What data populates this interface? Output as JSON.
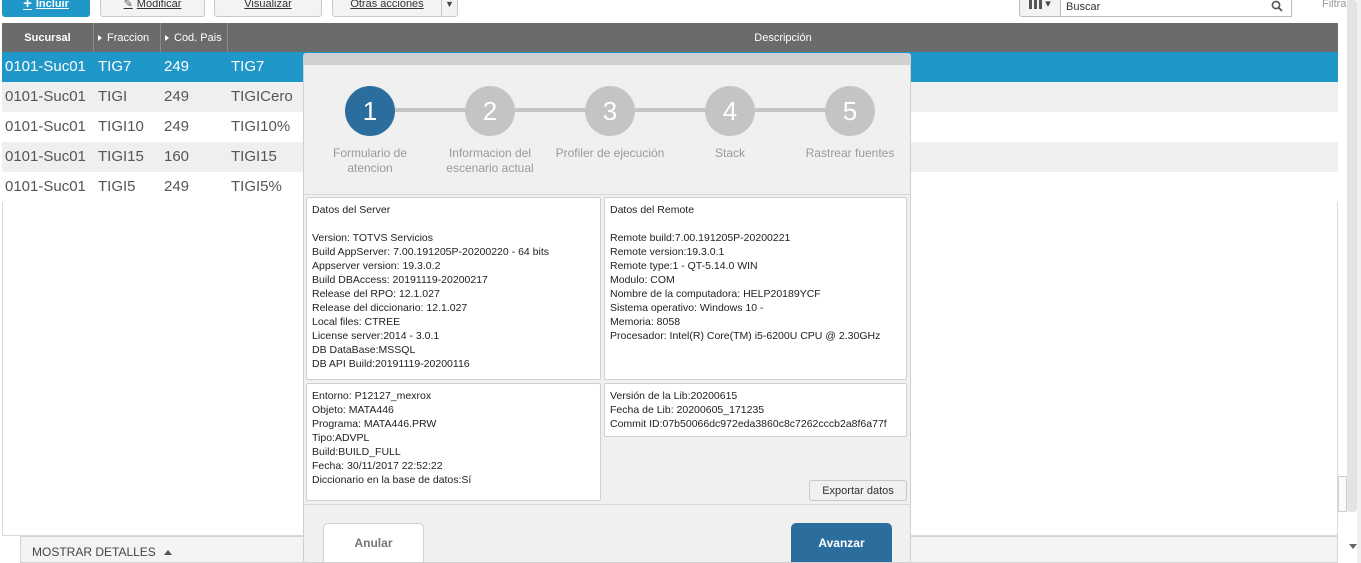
{
  "toolbar": {
    "include_label": "Incluir",
    "modify_label": "Modificar",
    "view_label": "Visualizar",
    "other_actions_label": "Otras acciones",
    "search_placeholder": "Buscar",
    "filter_label": "Filtrar"
  },
  "grid": {
    "columns": [
      "Sucursal",
      "Fraccion",
      "Cod. Pais",
      "Descripción"
    ],
    "rows": [
      {
        "sucursal": "0101-Suc01",
        "fraccion": "TIG7",
        "cod_pais": "249",
        "descripcion": "TIG7"
      },
      {
        "sucursal": "0101-Suc01",
        "fraccion": "TIGI",
        "cod_pais": "249",
        "descripcion": "TIGICero"
      },
      {
        "sucursal": "0101-Suc01",
        "fraccion": "TIGI10",
        "cod_pais": "249",
        "descripcion": "TIGI10%"
      },
      {
        "sucursal": "0101-Suc01",
        "fraccion": "TIGI15",
        "cod_pais": "160",
        "descripcion": "TIGI15"
      },
      {
        "sucursal": "0101-Suc01",
        "fraccion": "TIGI5",
        "cod_pais": "249",
        "descripcion": "TIGI5%"
      }
    ],
    "selected_row": 0
  },
  "footer": {
    "details_label": "MOSTRAR DETALLES"
  },
  "wizard": {
    "steps": [
      {
        "number": "1",
        "label": "Formulario de atencion"
      },
      {
        "number": "2",
        "label": "Informacion del escenario actual"
      },
      {
        "number": "3",
        "label": "Profiler de ejecución"
      },
      {
        "number": "4",
        "label": "Stack"
      },
      {
        "number": "5",
        "label": "Rastrear fuentes"
      }
    ],
    "active_step": 1,
    "server_panel": [
      "Datos del Server",
      "",
      "Version: TOTVS Servicios",
      "Build AppServer: 7.00.191205P-20200220 - 64 bits",
      "Appserver version: 19.3.0.2",
      "Build DBAccess: 20191119-20200217",
      "Release del RPO:  12.1.027",
      "Release del diccionario: 12.1.027",
      "Local files: CTREE",
      "License server:2014 - 3.0.1",
      "DB DataBase:MSSQL",
      "DB API Build:20191119-20200116"
    ],
    "remote_panel": [
      "Datos del Remote",
      "",
      "Remote build:7.00.191205P-20200221",
      "Remote version:19.3.0.1",
      "Remote type:1 - QT-5.14.0 WIN",
      "Modulo: COM",
      "Nombre de la computadora: HELP20189YCF",
      "Sistema operativo: Windows 10 -",
      "Memoria: 8058",
      "Procesador: Intel(R) Core(TM) i5-6200U CPU @ 2.30GHz"
    ],
    "env_panel": [
      "Entorno: P12127_mexrox",
      "Objeto: MATA446",
      "Programa: MATA446.PRW",
      "Tipo:ADVPL",
      "Build:BUILD_FULL",
      "Fecha: 30/11/2017 22:52:22",
      "Diccionario en la base de datos:Sí"
    ],
    "lib_panel": [
      "Versión de la Lib:20200615",
      "Fecha de Lib: 20200605_171235",
      "Commit ID:07b50066dc972eda3860c8c7262cccb2a8f6a77f"
    ],
    "export_label": "Exportar datos",
    "cancel_label": "Anular",
    "next_label": "Avanzar"
  },
  "colors": {
    "accent": "#1f97c9",
    "wizard_primary": "#2b6e9e",
    "header_bg": "#6b6b6b",
    "step_inactive": "#c4c4c4"
  }
}
